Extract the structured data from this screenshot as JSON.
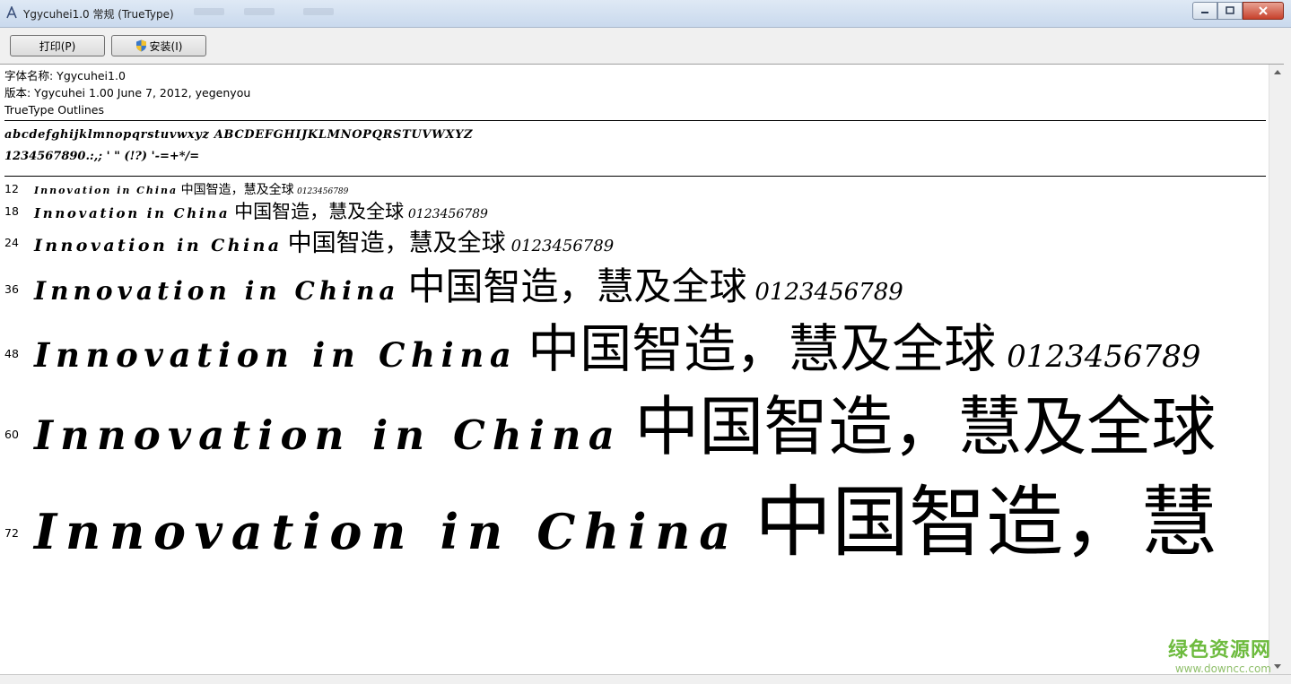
{
  "window": {
    "title": "Ygycuhei1.0 常规 (TrueType)"
  },
  "toolbar": {
    "print_label": "打印(P)",
    "install_label": "安装(I)"
  },
  "info": {
    "font_name": "字体名称: Ygycuhei1.0",
    "version": "版本: Ygycuhei 1.00 June 7, 2012, yegenyou",
    "type": "TrueType Outlines"
  },
  "charset": {
    "line1": "abcdefghijklmnopqrstuvwxyz ABCDEFGHIJKLMNOPQRSTUVWXYZ",
    "line2": "1234567890.:,; ' \" (!?) '-=+*/="
  },
  "samples": [
    {
      "size": "12",
      "latin": "Innovation in China",
      "cjk": "中国智造，慧及全球",
      "digits": "0123456789"
    },
    {
      "size": "18",
      "latin": "Innovation in China",
      "cjk": "中国智造，慧及全球",
      "digits": "0123456789"
    },
    {
      "size": "24",
      "latin": "Innovation in China",
      "cjk": "中国智造，慧及全球",
      "digits": "0123456789"
    },
    {
      "size": "36",
      "latin": "Innovation in China",
      "cjk": "中国智造，慧及全球",
      "digits": "0123456789"
    },
    {
      "size": "48",
      "latin": "Innovation in China",
      "cjk": "中国智造，慧及全球",
      "digits": "0123456789"
    },
    {
      "size": "60",
      "latin": "Innovation in China",
      "cjk": "中国智造，慧及全球",
      "digits": ""
    },
    {
      "size": "72",
      "latin": "Innovation in China",
      "cjk": "中国智造，慧",
      "digits": ""
    }
  ],
  "watermark": {
    "main": "绿色资源网",
    "url": "www.downcc.com"
  },
  "colors": {
    "titlebar": "#c9d9ed",
    "close_button": "#c7412c",
    "watermark_green": "#6dbb3e"
  }
}
